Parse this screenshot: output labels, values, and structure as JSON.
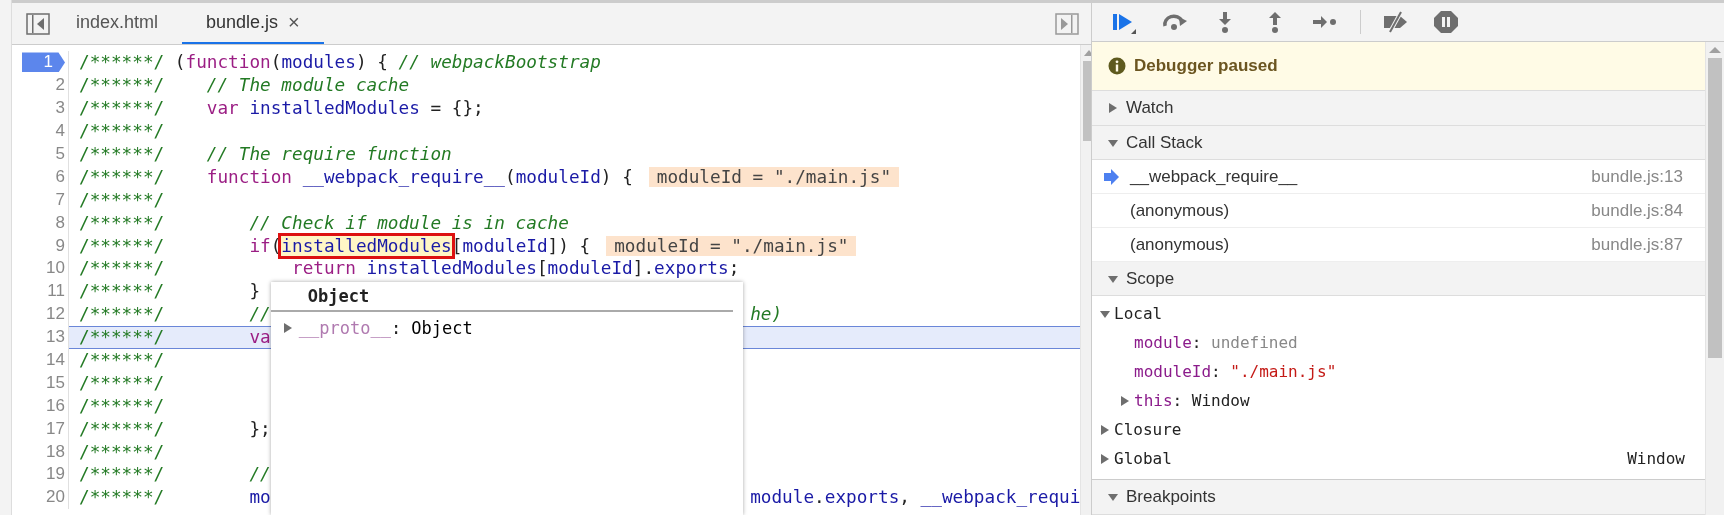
{
  "editor": {
    "tabs": [
      {
        "label": "index.html",
        "selected": false,
        "closable": false
      },
      {
        "label": "bundle.js",
        "selected": true,
        "closable": true,
        "close_label": "×"
      }
    ],
    "lines": [
      {
        "number": "1",
        "breakpoint": true,
        "current": false,
        "tokens": [
          {
            "kind": "marker",
            "text": "/******/"
          },
          {
            "kind": "plain",
            "text": " ("
          },
          {
            "kind": "keyword",
            "text": "function"
          },
          {
            "kind": "plain",
            "text": "("
          },
          {
            "kind": "ident",
            "text": "modules"
          },
          {
            "kind": "plain",
            "text": ") { "
          },
          {
            "kind": "comment",
            "text": "// webpackBootstrap"
          }
        ]
      },
      {
        "number": "2",
        "breakpoint": false,
        "current": false,
        "tokens": [
          {
            "kind": "marker",
            "text": "/******/"
          },
          {
            "kind": "comment",
            "text": "    // The module cache"
          }
        ]
      },
      {
        "number": "3",
        "breakpoint": false,
        "current": false,
        "tokens": [
          {
            "kind": "marker",
            "text": "/******/"
          },
          {
            "kind": "keyword",
            "text": "    var"
          },
          {
            "kind": "ident",
            "text": " installedModules"
          },
          {
            "kind": "plain",
            "text": " = {};"
          }
        ]
      },
      {
        "number": "4",
        "breakpoint": false,
        "current": false,
        "tokens": [
          {
            "kind": "marker",
            "text": "/******/"
          }
        ]
      },
      {
        "number": "5",
        "breakpoint": false,
        "current": false,
        "tokens": [
          {
            "kind": "marker",
            "text": "/******/"
          },
          {
            "kind": "comment",
            "text": "    // The require function"
          }
        ]
      },
      {
        "number": "6",
        "breakpoint": false,
        "current": false,
        "inline_value": "moduleId = \"./main.js\"",
        "tokens": [
          {
            "kind": "marker",
            "text": "/******/"
          },
          {
            "kind": "keyword",
            "text": "    function"
          },
          {
            "kind": "ident",
            "text": " __webpack_require__"
          },
          {
            "kind": "plain",
            "text": "("
          },
          {
            "kind": "ident",
            "text": "moduleId"
          },
          {
            "kind": "plain",
            "text": ") {"
          }
        ]
      },
      {
        "number": "7",
        "breakpoint": false,
        "current": false,
        "tokens": [
          {
            "kind": "marker",
            "text": "/******/"
          }
        ]
      },
      {
        "number": "8",
        "breakpoint": false,
        "current": false,
        "tokens": [
          {
            "kind": "marker",
            "text": "/******/"
          },
          {
            "kind": "comment",
            "text": "        // Check if module is in cache"
          }
        ]
      },
      {
        "number": "9",
        "breakpoint": false,
        "current": false,
        "inline_value": "moduleId = \"./main.js\"",
        "tokens": [
          {
            "kind": "marker",
            "text": "/******/"
          },
          {
            "kind": "keyword",
            "text": "        if"
          },
          {
            "kind": "plain",
            "text": "("
          },
          {
            "kind": "hovered",
            "text": "installedModules"
          },
          {
            "kind": "plain",
            "text": "["
          },
          {
            "kind": "ident",
            "text": "moduleId"
          },
          {
            "kind": "plain",
            "text": "]) {"
          }
        ]
      },
      {
        "number": "10",
        "breakpoint": false,
        "current": false,
        "tokens": [
          {
            "kind": "marker",
            "text": "/******/"
          },
          {
            "kind": "keyword",
            "text": "            return"
          },
          {
            "kind": "ident",
            "text": " installedModules"
          },
          {
            "kind": "plain",
            "text": "["
          },
          {
            "kind": "ident",
            "text": "moduleId"
          },
          {
            "kind": "plain",
            "text": "]."
          },
          {
            "kind": "ident",
            "text": "exports"
          },
          {
            "kind": "plain",
            "text": ";"
          }
        ]
      },
      {
        "number": "11",
        "breakpoint": false,
        "current": false,
        "tokens": [
          {
            "kind": "marker",
            "text": "/******/"
          },
          {
            "kind": "plain",
            "text": "        }"
          }
        ]
      },
      {
        "number": "12",
        "breakpoint": false,
        "current": false,
        "tokens": [
          {
            "kind": "marker",
            "text": "/******/"
          },
          {
            "kind": "comment",
            "text": "        //"
          }
        ],
        "after_popup": [
          {
            "kind": "comment",
            "text": "he)"
          }
        ]
      },
      {
        "number": "13",
        "breakpoint": false,
        "current": true,
        "tokens": [
          {
            "kind": "marker",
            "text": "/******/"
          },
          {
            "kind": "keyword",
            "text": "        va"
          }
        ]
      },
      {
        "number": "14",
        "breakpoint": false,
        "current": false,
        "tokens": [
          {
            "kind": "marker",
            "text": "/******/"
          }
        ]
      },
      {
        "number": "15",
        "breakpoint": false,
        "current": false,
        "tokens": [
          {
            "kind": "marker",
            "text": "/******/"
          }
        ]
      },
      {
        "number": "16",
        "breakpoint": false,
        "current": false,
        "tokens": [
          {
            "kind": "marker",
            "text": "/******/"
          }
        ]
      },
      {
        "number": "17",
        "breakpoint": false,
        "current": false,
        "tokens": [
          {
            "kind": "marker",
            "text": "/******/"
          },
          {
            "kind": "plain",
            "text": "        };"
          }
        ]
      },
      {
        "number": "18",
        "breakpoint": false,
        "current": false,
        "tokens": [
          {
            "kind": "marker",
            "text": "/******/"
          }
        ]
      },
      {
        "number": "19",
        "breakpoint": false,
        "current": false,
        "tokens": [
          {
            "kind": "marker",
            "text": "/******/"
          },
          {
            "kind": "comment",
            "text": "        //"
          }
        ]
      },
      {
        "number": "20",
        "breakpoint": false,
        "current": false,
        "tokens": [
          {
            "kind": "marker",
            "text": "/******/"
          },
          {
            "kind": "ident",
            "text": "        mo"
          }
        ],
        "after_popup": [
          {
            "kind": "ident",
            "text": "module"
          },
          {
            "kind": "plain",
            "text": "."
          },
          {
            "kind": "ident",
            "text": "exports"
          },
          {
            "kind": "plain",
            "text": ", "
          },
          {
            "kind": "ident",
            "text": "__webpack_requi"
          }
        ]
      }
    ],
    "popup": {
      "title": "Object",
      "properties": [
        {
          "name": "__proto__",
          "separator": ":",
          "value": "Object",
          "expanded": false
        }
      ]
    }
  },
  "debugger": {
    "toolbar": [
      {
        "kind": "resume"
      },
      {
        "kind": "step-over"
      },
      {
        "kind": "step-into"
      },
      {
        "kind": "step-out"
      },
      {
        "kind": "step"
      },
      {
        "kind": "divider"
      },
      {
        "kind": "deactivate"
      },
      {
        "kind": "pause-exceptions"
      }
    ],
    "status": "Debugger paused",
    "sections": [
      {
        "kind": "plain",
        "title": "Watch",
        "expanded": false
      },
      {
        "kind": "callstack",
        "title": "Call Stack",
        "expanded": true,
        "frames": [
          {
            "function": "__webpack_require__",
            "location": "bundle.js:13",
            "selected": true
          },
          {
            "function": "(anonymous)",
            "location": "bundle.js:84",
            "selected": false
          },
          {
            "function": "(anonymous)",
            "location": "bundle.js:87",
            "selected": false
          }
        ]
      },
      {
        "kind": "scope",
        "title": "Scope",
        "expanded": true,
        "items": [
          {
            "name": "Local",
            "expanded": true,
            "children": [
              {
                "name": "module",
                "separator": ":",
                "value": "undefined",
                "kind": "undefined"
              },
              {
                "name": "moduleId",
                "separator": ":",
                "value": "\"./main.js\"",
                "kind": "string"
              },
              {
                "name": "this",
                "separator": ":",
                "value": "Window",
                "kind": "object",
                "expanded": false
              }
            ]
          },
          {
            "name": "Closure",
            "expanded": false
          },
          {
            "name": "Global",
            "expanded": false,
            "value": "Window"
          }
        ]
      },
      {
        "kind": "plain",
        "title": "Breakpoints",
        "expanded": true
      }
    ]
  }
}
